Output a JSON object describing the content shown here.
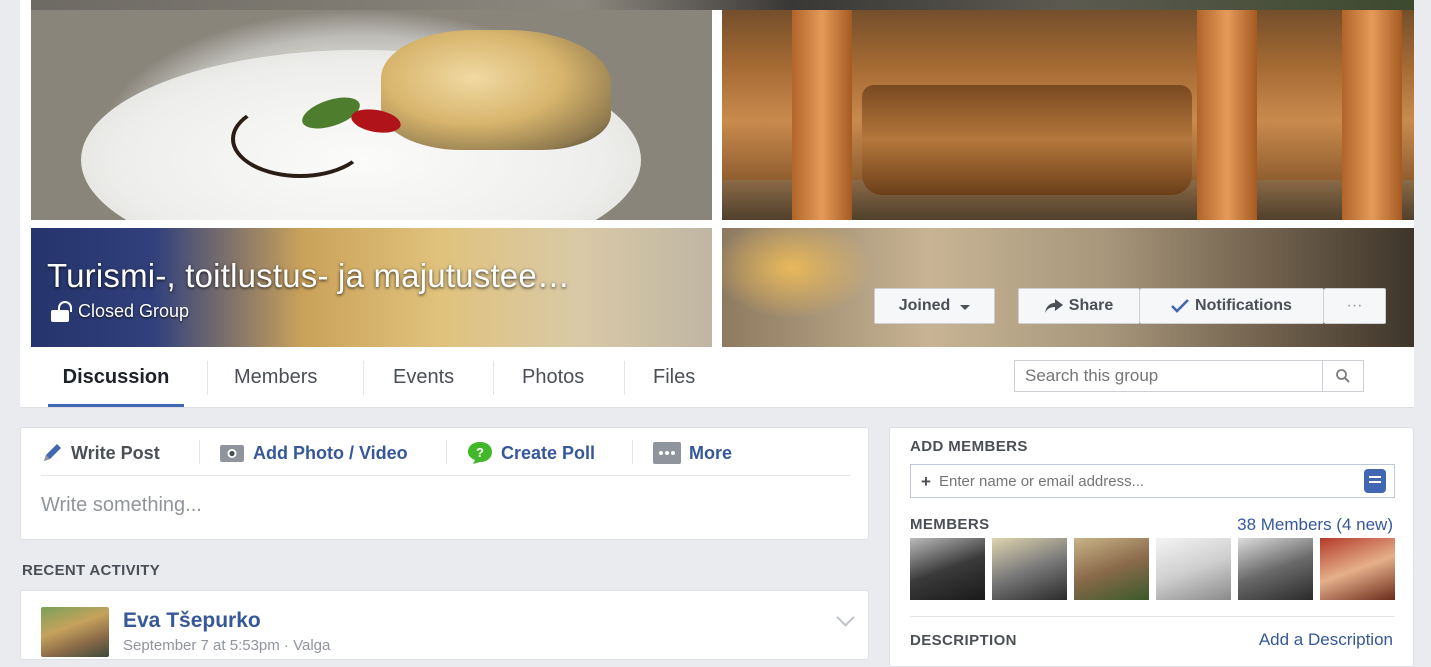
{
  "group": {
    "title": "Turismi-, toitlustus- ja majutustee…",
    "type": "Closed Group"
  },
  "cover_buttons": {
    "joined": "Joined",
    "share": "Share",
    "notifications": "Notifications",
    "more": "···"
  },
  "tabs": [
    {
      "label": "Discussion",
      "active": true
    },
    {
      "label": "Members",
      "active": false
    },
    {
      "label": "Events",
      "active": false
    },
    {
      "label": "Photos",
      "active": false
    },
    {
      "label": "Files",
      "active": false
    }
  ],
  "search": {
    "placeholder": "Search this group"
  },
  "composer": {
    "tabs": [
      {
        "label": "Write Post",
        "icon": "pencil-icon"
      },
      {
        "label": "Add Photo / Video",
        "icon": "camera-icon"
      },
      {
        "label": "Create Poll",
        "icon": "poll-icon"
      },
      {
        "label": "More",
        "icon": "more-icon"
      }
    ],
    "placeholder": "Write something..."
  },
  "recent_activity": {
    "heading": "RECENT ACTIVITY",
    "post": {
      "author": "Eva Tšepurko",
      "meta": "September 7 at 5:53pm · Valga"
    }
  },
  "sidebar": {
    "add_members": {
      "heading": "ADD MEMBERS",
      "placeholder": "Enter name or email address..."
    },
    "members": {
      "heading": "MEMBERS",
      "count_label": "38 Members (4 new)",
      "photo_colors": [
        "#3a3a3a",
        "#6b6b6b",
        "#8a7a5a",
        "#d8d8d8",
        "#5a5a5a",
        "#9a4a3a"
      ]
    },
    "description": {
      "heading": "DESCRIPTION",
      "action": "Add a Description"
    }
  },
  "colors": {
    "link": "#365899",
    "accent": "#4267b2",
    "background": "#e9ebee"
  }
}
